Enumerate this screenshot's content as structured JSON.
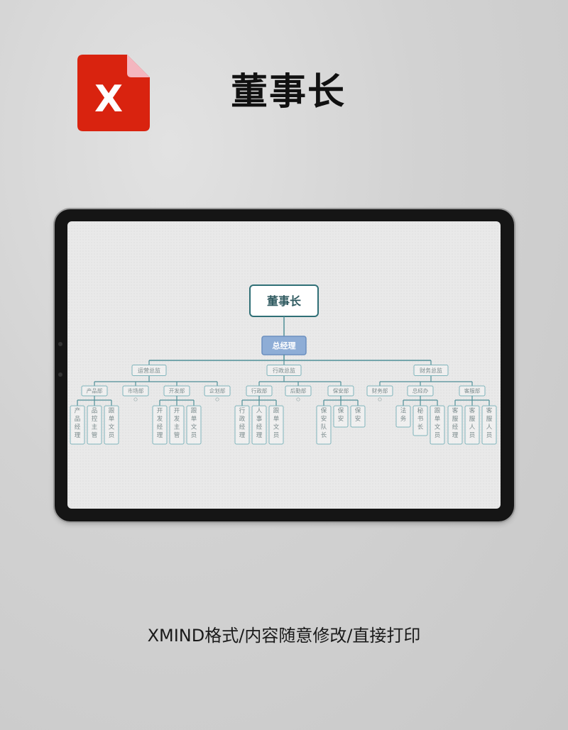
{
  "header": {
    "icon": "xmind-file-icon",
    "icon_letter": "X",
    "title": "董事长",
    "colors": {
      "icon_red": "#d9230f",
      "icon_fold": "#f4b6bf"
    }
  },
  "org_chart": {
    "root": "董事长",
    "level1": "总经理",
    "directors": [
      {
        "label": "运营总监",
        "departments": [
          {
            "label": "产品部",
            "roles": [
              "产品经理",
              "品控主管",
              "跟单文员"
            ]
          },
          {
            "label": "市场部",
            "roles": [],
            "collapsed": true
          },
          {
            "label": "开发部",
            "roles": [
              "开发经理",
              "开发主管",
              "跟单文员"
            ]
          },
          {
            "label": "企划部",
            "roles": [],
            "collapsed": true
          }
        ]
      },
      {
        "label": "行政总监",
        "departments": [
          {
            "label": "行政部",
            "roles": [
              "行政经理",
              "人事经理",
              "跟单文员"
            ]
          },
          {
            "label": "后勤部",
            "roles": [],
            "collapsed": true
          },
          {
            "label": "保安部",
            "roles": [
              "保安队长",
              "保安",
              "保安"
            ]
          }
        ]
      },
      {
        "label": "财务总监",
        "departments": [
          {
            "label": "财务部",
            "roles": [],
            "collapsed": true
          },
          {
            "label": "总经办",
            "roles": [
              "法务",
              "秘书长",
              "跟单文员"
            ]
          },
          {
            "label": "客服部",
            "roles": [
              "客服经理",
              "客服人员",
              "客服人员"
            ]
          }
        ]
      }
    ],
    "colors": {
      "line": "#4f8f98",
      "root_border": "#2f6f76",
      "root_text": "#2f5a60",
      "level1_fill": "#8eadd6",
      "level1_text": "#ffffff",
      "node_border": "#7fb4bb",
      "node_text": "#7a8a8c"
    }
  },
  "footer": {
    "caption": "XMIND格式/内容随意修改/直接打印"
  }
}
